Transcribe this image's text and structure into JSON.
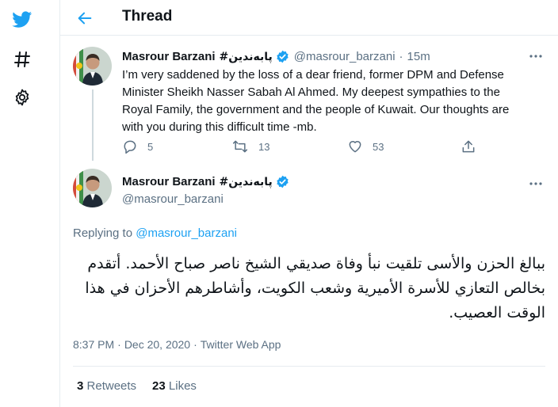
{
  "app": {
    "logo_icon": "twitter-bird-icon",
    "brand_color": "#1da1f2"
  },
  "nav": {
    "items": [
      {
        "name": "explore",
        "icon": "hashtag-icon"
      },
      {
        "name": "settings",
        "icon": "gear-icon"
      }
    ]
  },
  "header": {
    "title": "Thread",
    "back_icon": "arrow-left-icon"
  },
  "tweet1": {
    "author_name": "Masrour Barzani",
    "author_name_ar": "#پابەندین",
    "handle": "@masrour_barzani",
    "separator": "·",
    "time": "15m",
    "text": "I’m very saddened by the loss of a dear friend, former DPM and Defense Minister Sheikh Nasser Sabah Al Ahmed. My deepest sympathies to the Royal Family, the government and the people of Kuwait. Our thoughts are with you during this difficult time -mb.",
    "actions": {
      "reply_count": "5",
      "retweet_count": "13",
      "like_count": "53"
    }
  },
  "tweet2": {
    "author_name": "Masrour Barzani",
    "author_name_ar": "#پابەندین",
    "handle": "@masrour_barzani",
    "replying_label": "Replying to",
    "replying_to": "@masrour_barzani",
    "text": "ببالغ الحزن والأسى تلقيت نبأ وفاة صديقي الشيخ ناصر صباح الأحمد. أتقدم بخالص التعازي للأسرة الأميرية وشعب الكويت، وأشاطرهم الأحزان في هذا الوقت العصيب.",
    "time": "8:37 PM",
    "date": "Dec 20, 2020",
    "source": "Twitter Web App",
    "separator": "·",
    "retweets": "3",
    "retweets_label": "Retweets",
    "likes": "23",
    "likes_label": "Likes"
  }
}
